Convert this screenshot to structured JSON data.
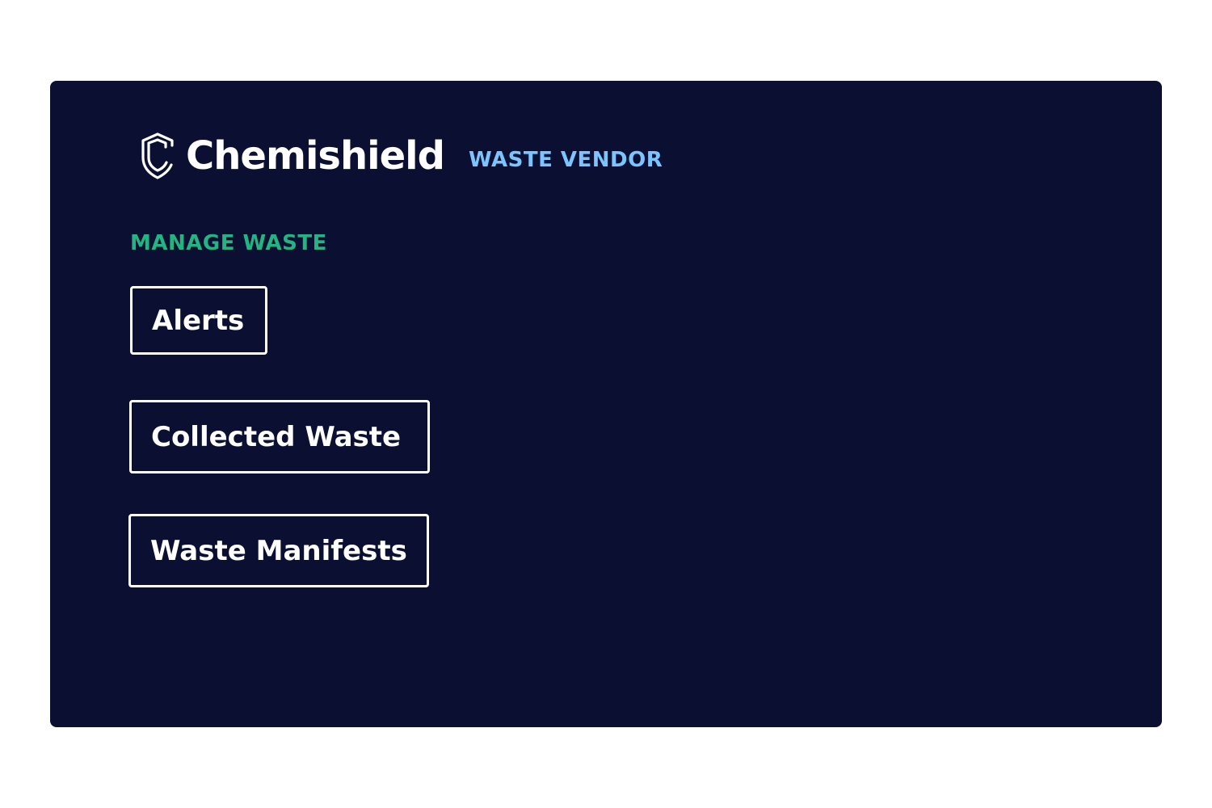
{
  "brand": {
    "name": "Chemishield",
    "role": "WASTE VENDOR",
    "logo_icon": "shield-c-icon"
  },
  "section": {
    "label": "MANAGE WASTE"
  },
  "nav": {
    "items": [
      {
        "label": "Alerts"
      },
      {
        "label": "Collected Waste"
      },
      {
        "label": "Waste Manifests"
      }
    ]
  },
  "colors": {
    "panel_background": "#0b0f31",
    "role_text": "#7cc4ff",
    "section_label": "#23b482",
    "button_border": "#ffffff"
  }
}
